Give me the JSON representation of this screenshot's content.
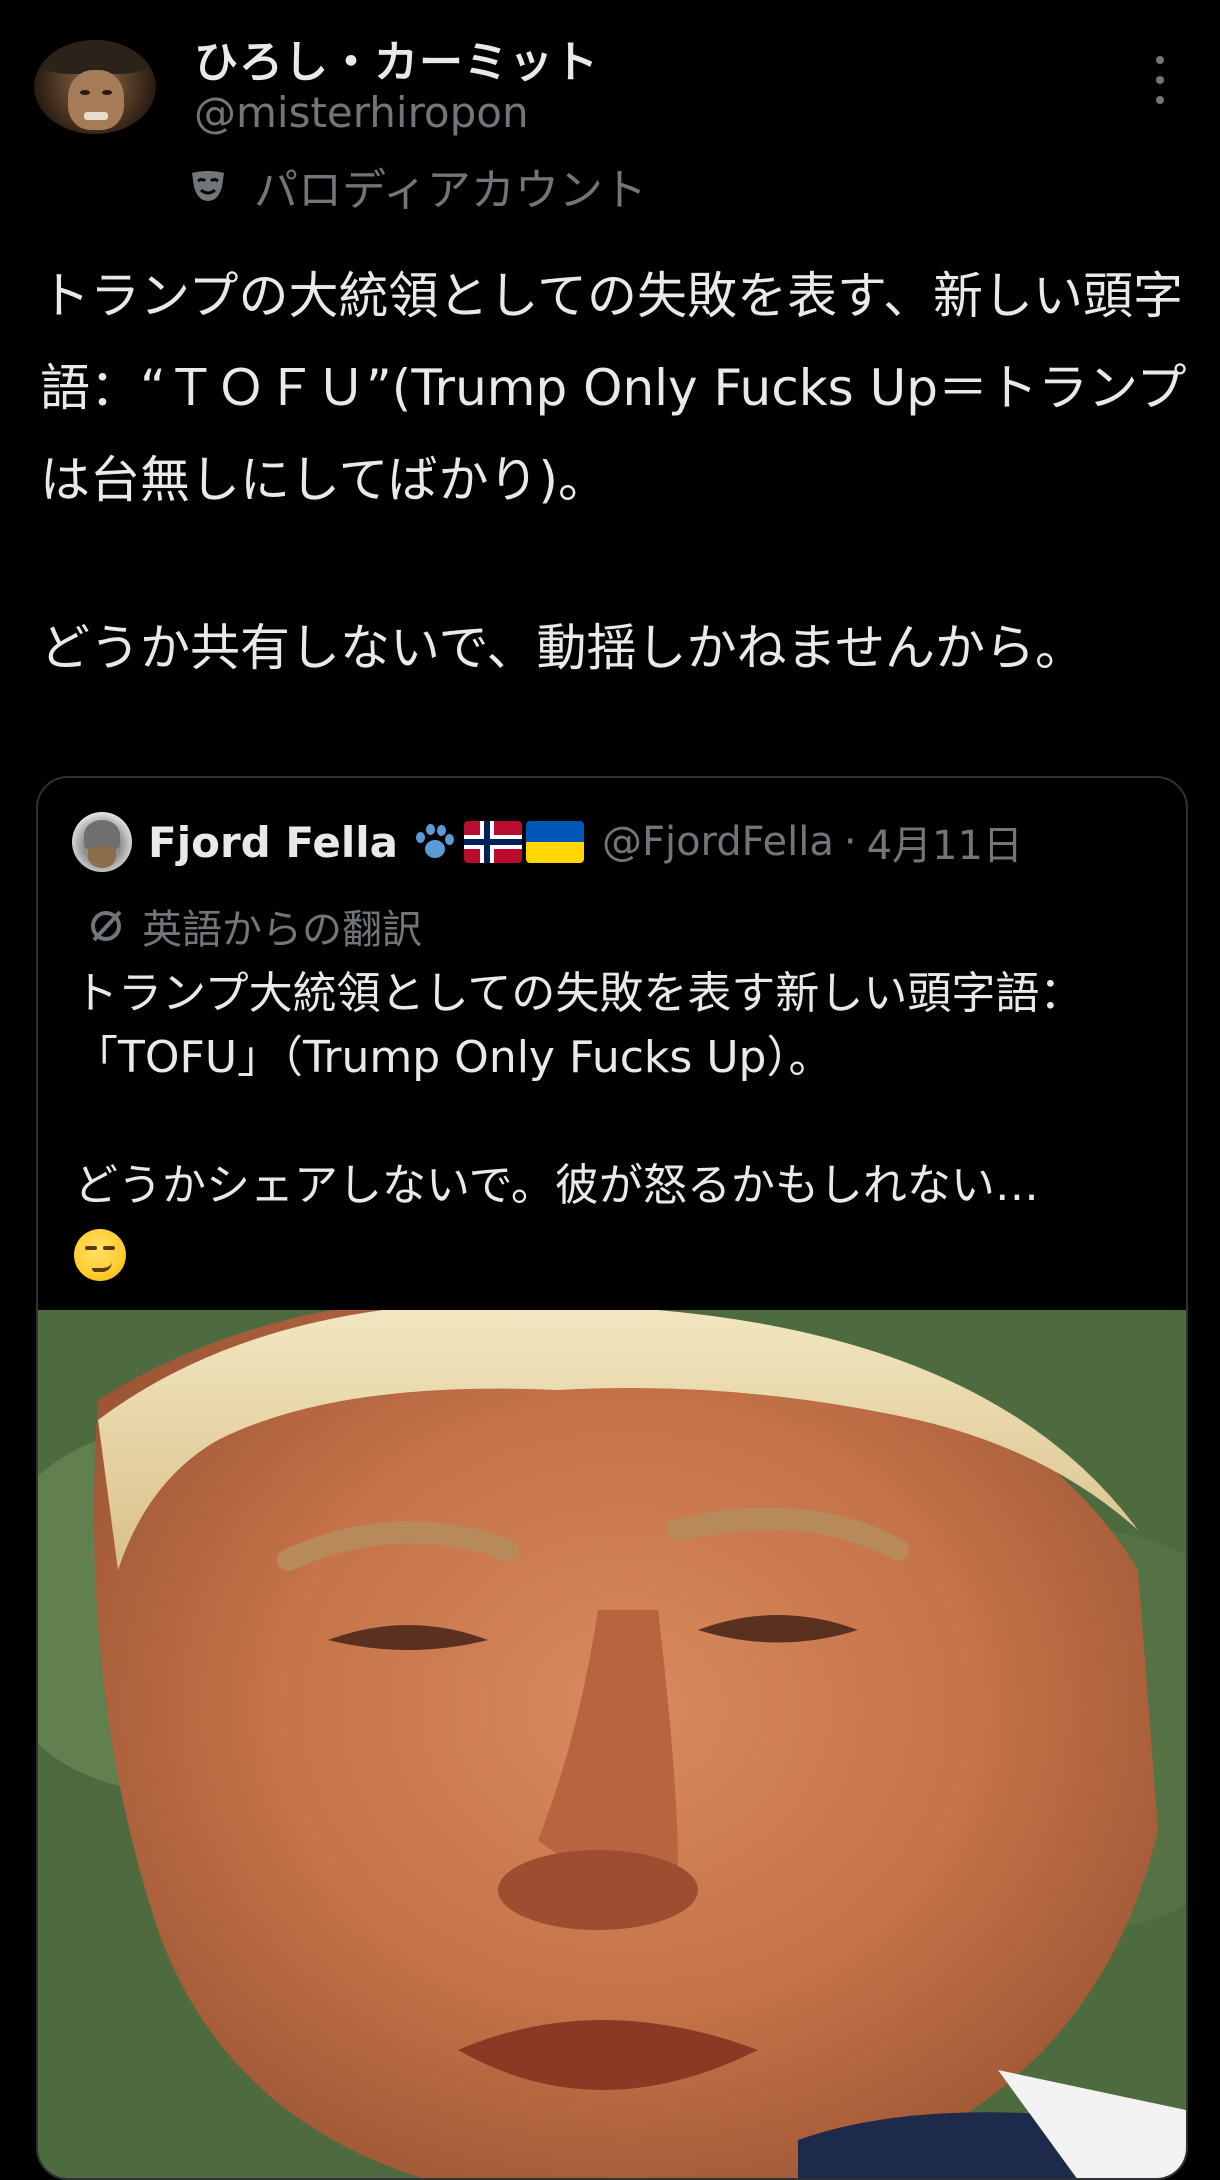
{
  "author": {
    "display_name": "ひろし・カーミット",
    "handle": "@misterhiropon",
    "label": "パロディアカウント"
  },
  "tweet": {
    "paragraph1": "トランプの大統領としての失敗を表す、新しい頭字語：“ＴＯＦＵ”(Trump Only Fucks Up＝トランプは台無しにしてばかり)。",
    "paragraph2": "どうか共有しないで、動揺しかねませんから。"
  },
  "quoted_tweet": {
    "display_name": "Fjord Fella",
    "handle": "@FjordFella",
    "separator": "·",
    "date": "4月11日",
    "translation_label": "英語からの翻訳",
    "paragraph1": "トランプ大統領としての失敗を表す新しい頭字語：「TOFU」（Trump Only Fucks Up）。",
    "paragraph2": "どうかシェアしないで。彼が怒るかもしれない…"
  },
  "icons": {
    "more": "more-vertical-icon",
    "parody": "mask-icon",
    "translate": "translate-icon",
    "paw": "paw-icon",
    "flags": [
      "norway-flag-icon",
      "ukraine-flag-icon"
    ],
    "emoji": "smirking-face-emoji"
  },
  "colors": {
    "background": "#000000",
    "text": "#e7e9ea",
    "secondary_text": "#71767b",
    "border": "#2f3336"
  }
}
